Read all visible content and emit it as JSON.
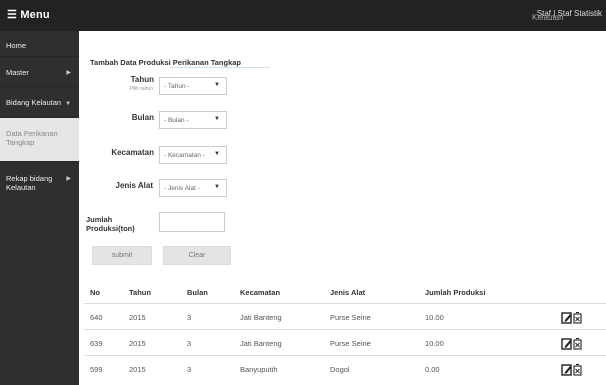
{
  "topbar": {
    "menu_label": "☰ Menu",
    "user_text": "Staf Statistik",
    "user_overlap": "Kelautan",
    "user_prefix": "Staf | "
  },
  "sidebar": {
    "items": [
      {
        "label": "Home"
      },
      {
        "label": "Master"
      },
      {
        "label": "Bidang Kelautan"
      },
      {
        "label": "Data Perikanan Tangkap"
      },
      {
        "label": "Rekap bidang Kelautan"
      }
    ]
  },
  "form": {
    "title": "Tambah Data Produksi Perikanan Tangkap",
    "tahun_label": "Tahun",
    "tahun_hint": "Pilih tahun",
    "tahun_value": "- Tahun -",
    "bulan_label": "Bulan",
    "bulan_value": "- Bulan -",
    "kecamatan_label": "Kecamatan",
    "kecamatan_value": "- Kecamatan -",
    "jenis_label": "Jenis Alat",
    "jenis_value": "- Jenis Alat -",
    "jumlah_label": "Jumlah Produksi(ton)",
    "jumlah_value": "",
    "submit_label": "submit",
    "clear_label": "Clear"
  },
  "table": {
    "headers": [
      "No",
      "Tahun",
      "Bulan",
      "Kecamatan",
      "Jenis Alat",
      "Jumlah Produksi"
    ],
    "rows": [
      [
        "640",
        "2015",
        "3",
        "Jati Banteng",
        "Purse Seine",
        "10.00"
      ],
      [
        "639",
        "2015",
        "3",
        "Jati Banteng",
        "Purse Seine",
        "10.00"
      ],
      [
        "599",
        "2015",
        "3",
        "Banyuputih",
        "Dogol",
        "0.00"
      ]
    ]
  }
}
